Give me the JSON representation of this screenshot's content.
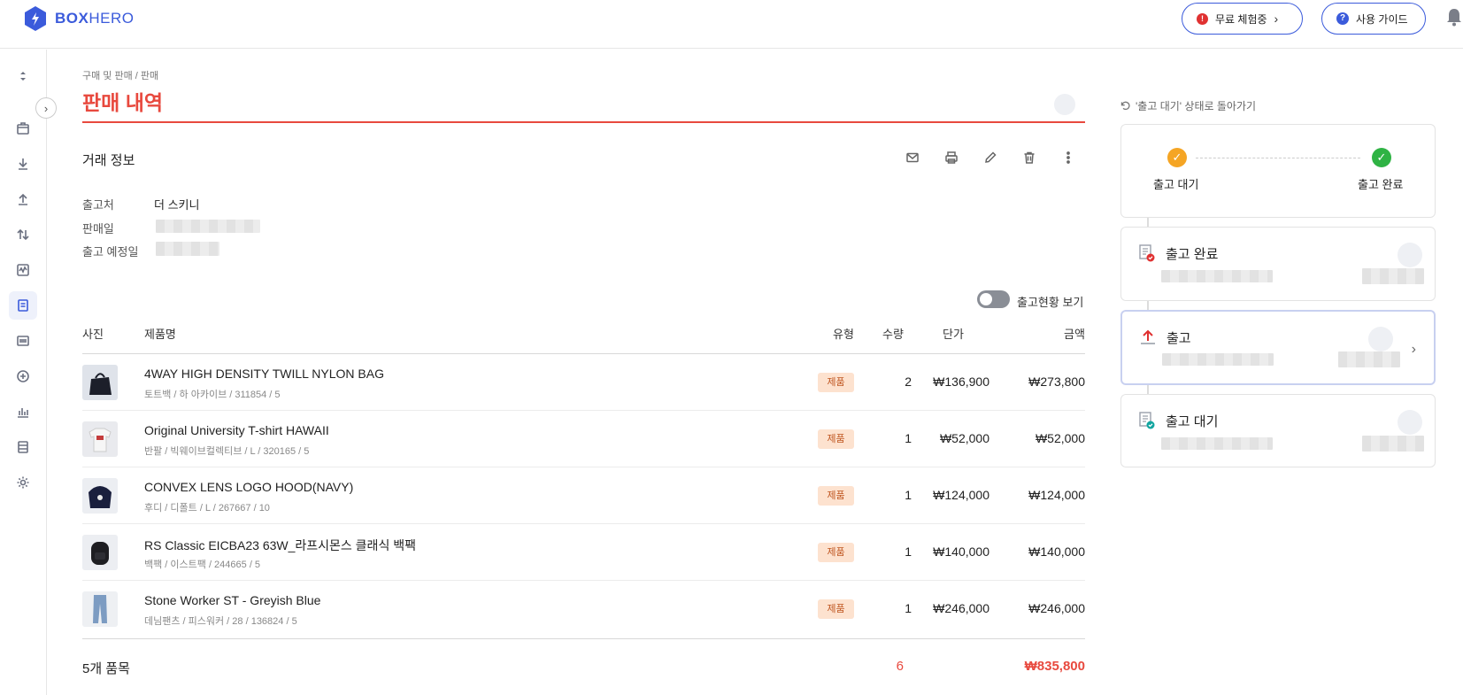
{
  "brand": {
    "name_bold": "BOX",
    "name_light": "HERO",
    "color": "#3b5bdb"
  },
  "header": {
    "trial": {
      "badge": "!",
      "label": "무료 체험중"
    },
    "guide": {
      "badge": "?",
      "label": "사용 가이드"
    }
  },
  "sidebar": {
    "icons": [
      "sort-icon",
      "box-icon",
      "stock-in-icon",
      "stock-out-icon",
      "transfer-icon",
      "adjust-icon",
      "sales-icon",
      "barcode-icon",
      "add-icon",
      "report-icon",
      "data-icon",
      "settings-icon"
    ],
    "active": "sales-icon"
  },
  "page": {
    "breadcrumb": "구매 및 판매  /  판매",
    "title": "판매 내역",
    "accent": "#e8493e"
  },
  "deal": {
    "section_title": "거래 정보",
    "fields": [
      {
        "label": "출고처",
        "value": "더 스키니"
      },
      {
        "label": "판매일",
        "value": ""
      },
      {
        "label": "출고 예정일",
        "value": ""
      }
    ],
    "tools": [
      "mail-icon",
      "print-icon",
      "edit-icon",
      "delete-icon",
      "more-icon"
    ]
  },
  "table": {
    "toggle_label": "출고현황 보기",
    "headers": {
      "photo": "사진",
      "name": "제품명",
      "type": "유형",
      "qty": "수량",
      "price": "단가",
      "amount": "금액"
    },
    "rows": [
      {
        "name": "4WAY HIGH DENSITY TWILL NYLON BAG",
        "sub": "토트백 / 하 아카이브 / 311854 / 5",
        "type": "제품",
        "qty": "2",
        "price": "₩136,900",
        "amount": "₩273,800",
        "thumb": "bag"
      },
      {
        "name": "Original University T-shirt HAWAII",
        "sub": "반팔 / 빅웨이브컬렉티브 / L / 320165 / 5",
        "type": "제품",
        "qty": "1",
        "price": "₩52,000",
        "amount": "₩52,000",
        "thumb": "tshirt"
      },
      {
        "name": "CONVEX LENS LOGO HOOD(NAVY)",
        "sub": "후디 / 디폴트 / L / 267667 / 10",
        "type": "제품",
        "qty": "1",
        "price": "₩124,000",
        "amount": "₩124,000",
        "thumb": "hood"
      },
      {
        "name": "RS Classic EICBA23 63W_라프시몬스 클래식 백팩",
        "sub": "백팩 / 이스트팩 / 244665 / 5",
        "type": "제품",
        "qty": "1",
        "price": "₩140,000",
        "amount": "₩140,000",
        "thumb": "backpack"
      },
      {
        "name": "Stone Worker ST - Greyish Blue",
        "sub": "데님팬츠 / 피스워커 / 28 / 136824 / 5",
        "type": "제품",
        "qty": "1",
        "price": "₩246,000",
        "amount": "₩246,000",
        "thumb": "jeans"
      }
    ],
    "footer": {
      "count": "5개 품목",
      "total_qty": "6",
      "total_amount": "₩835,800"
    }
  },
  "status": {
    "revert_label": "'출고 대기' 상태로 돌아가기",
    "steps": [
      {
        "label": "출고 대기",
        "color": "#f5a524"
      },
      {
        "label": "출고 완료",
        "color": "#2fb344"
      }
    ],
    "logs": [
      {
        "title": "출고 완료",
        "icon": "doc-check-red-icon"
      },
      {
        "title": "출고",
        "icon": "upload-red-icon"
      },
      {
        "title": "출고 대기",
        "icon": "doc-check-teal-icon"
      }
    ]
  }
}
